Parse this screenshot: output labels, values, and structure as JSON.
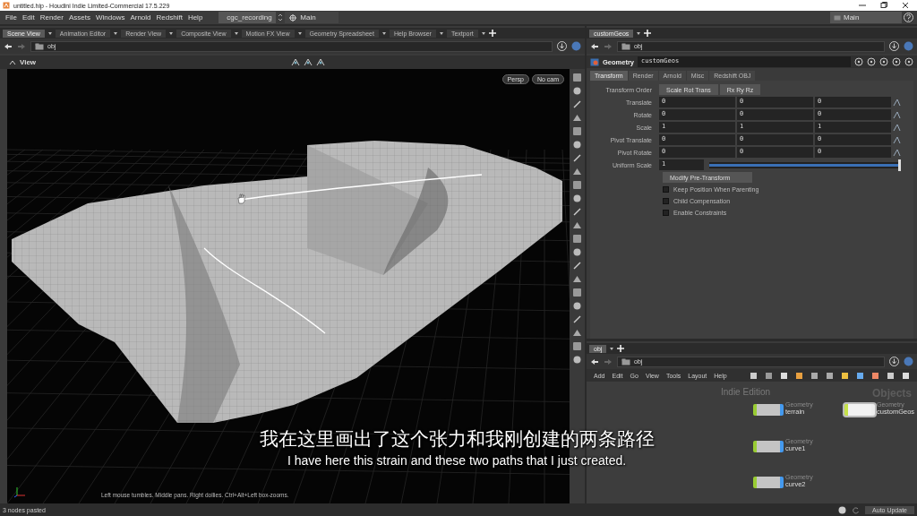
{
  "window": {
    "title": "untitled.hip - Houdini Indie Limited-Commercial 17.5.229"
  },
  "menu": [
    "File",
    "Edit",
    "Render",
    "Assets",
    "Windows",
    "Arnold",
    "Redshift",
    "Help"
  ],
  "desktop": "cgc_recording",
  "context": "Main",
  "right_context": "Main",
  "scene_pane": {
    "tabs": [
      {
        "label": "Scene View",
        "selected": true
      },
      {
        "label": "Animation Editor",
        "selected": false
      },
      {
        "label": "Render View",
        "selected": false
      },
      {
        "label": "Composite View",
        "selected": false
      },
      {
        "label": "Motion FX View",
        "selected": false
      },
      {
        "label": "Geometry Spreadsheet",
        "selected": false
      },
      {
        "label": "Help Browser",
        "selected": false
      },
      {
        "label": "Textport",
        "selected": false
      }
    ],
    "path": "obj",
    "view_title": "View",
    "camera_buttons": [
      "Persp",
      "No cam"
    ],
    "hint": "Left mouse tumbles. Middle pans. Right dollies. Ctrl+Alt+Left box-zooms."
  },
  "param_pane": {
    "pane_tabs": [
      {
        "label": "customGeos",
        "selected": true
      }
    ],
    "path": "obj",
    "node_type": "Geometry",
    "node_name": "customGeos",
    "tabs": [
      {
        "label": "Transform",
        "selected": true
      },
      {
        "label": "Render",
        "selected": false
      },
      {
        "label": "Arnold",
        "selected": false
      },
      {
        "label": "Misc",
        "selected": false
      },
      {
        "label": "Redshift OBJ",
        "selected": false
      }
    ],
    "transform_order_label": "Transform Order",
    "transform_order": [
      "Scale Rot Trans",
      "Rx Ry Rz"
    ],
    "rows": [
      {
        "label": "Translate",
        "values": [
          "0",
          "0",
          "0"
        ]
      },
      {
        "label": "Rotate",
        "values": [
          "0",
          "0",
          "0"
        ]
      },
      {
        "label": "Scale",
        "values": [
          "1",
          "1",
          "1"
        ]
      },
      {
        "label": "Pivot Translate",
        "values": [
          "0",
          "0",
          "0"
        ]
      },
      {
        "label": "Pivot Rotate",
        "values": [
          "0",
          "0",
          "0"
        ]
      }
    ],
    "uniform_scale": {
      "label": "Uniform Scale",
      "value": "1",
      "level": 1
    },
    "modify": "Modify Pre-Transform",
    "checkboxes": [
      {
        "label": "Keep Position When Parenting",
        "checked": false
      },
      {
        "label": "Child Compensation",
        "checked": false
      },
      {
        "label": "Enable Constraints",
        "checked": false
      }
    ]
  },
  "network_pane": {
    "pane_tabs": [
      {
        "label": "obj",
        "selected": true
      }
    ],
    "path": "obj",
    "menu": [
      "Add",
      "Edit",
      "Go",
      "View",
      "Tools",
      "Layout",
      "Help"
    ],
    "edition_label": "Indie Edition",
    "context_label": "Objects",
    "nodes": [
      {
        "type": "Geometry",
        "name": "terrain",
        "selected": false
      },
      {
        "type": "Geometry",
        "name": "customGeos",
        "selected": true
      },
      {
        "type": "Geometry",
        "name": "curve1",
        "selected": false
      },
      {
        "type": "Geometry",
        "name": "curve2",
        "selected": false
      }
    ]
  },
  "subtitles": {
    "chinese": "我在这里画出了这个张力和我刚创建的两条路径",
    "english": "I have here this strain and these two paths that I just created."
  },
  "status_bar": {
    "message": "3 nodes pasted",
    "update_mode": "Auto Update"
  }
}
